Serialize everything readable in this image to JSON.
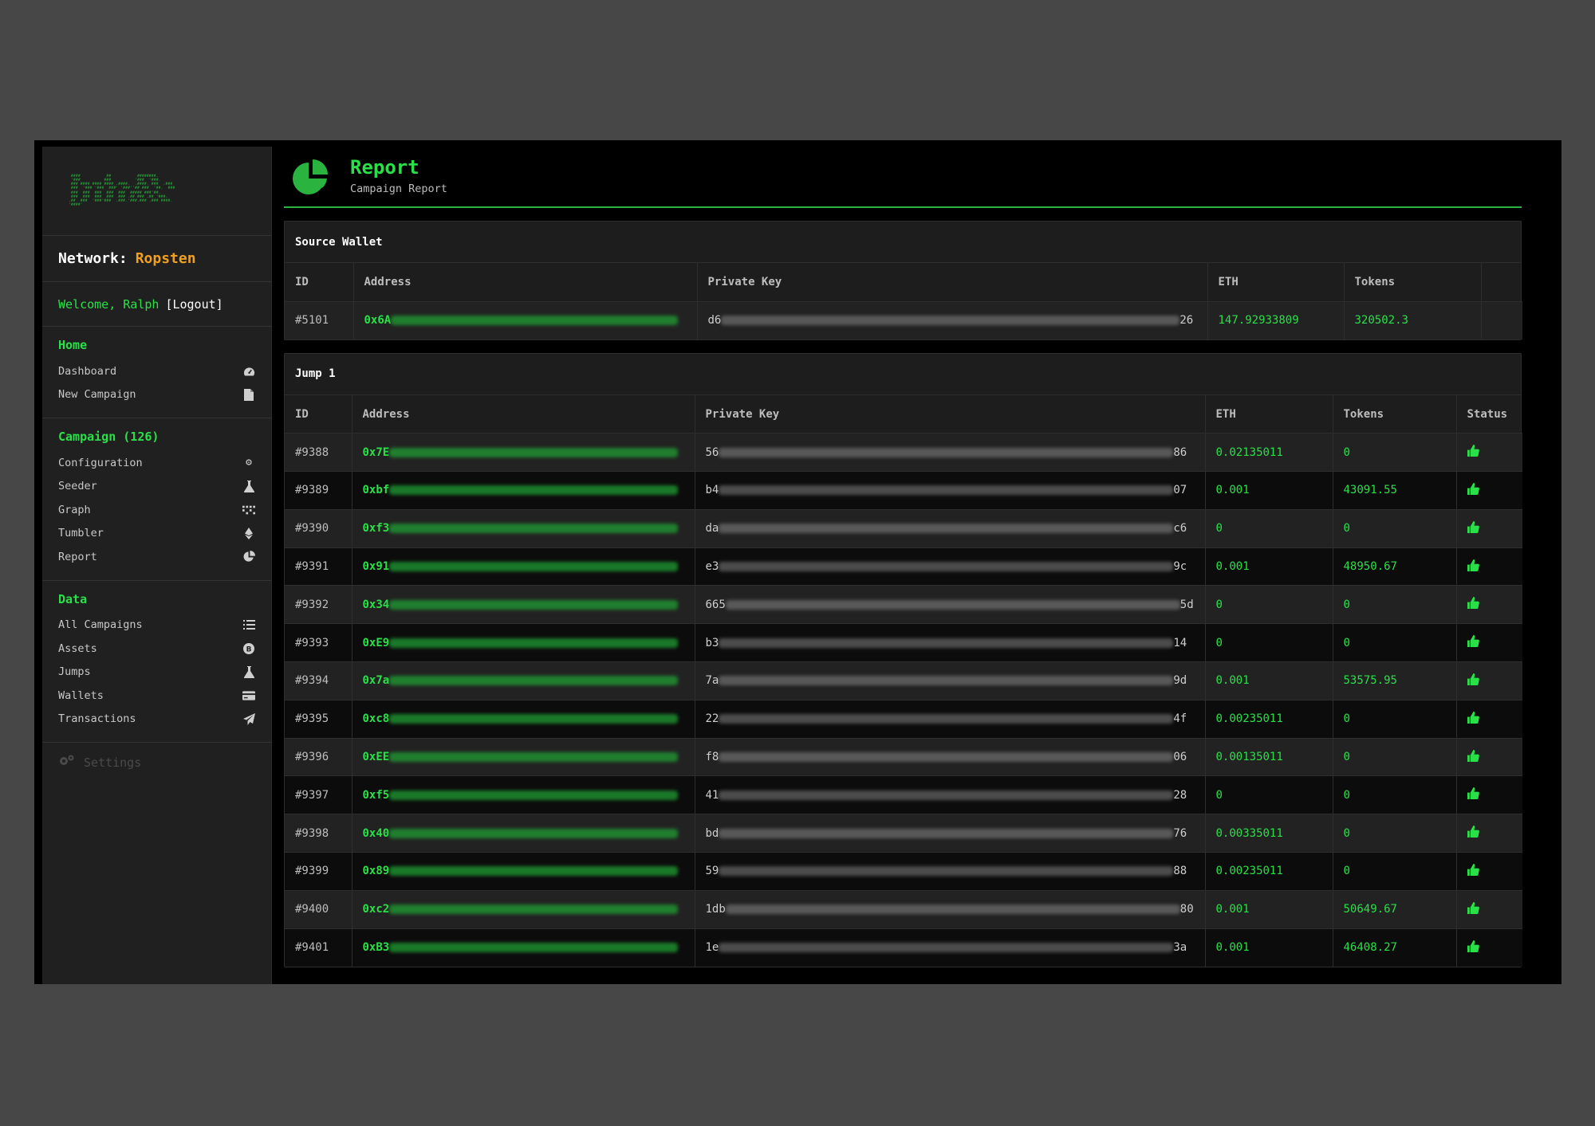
{
  "sidebar": {
    "network_label": "Network:",
    "network_value": "Ropsten",
    "welcome": "Welcome, Ralph",
    "logout": "[Logout]",
    "home_heading": "Home",
    "home_items": [
      {
        "label": "Dashboard",
        "icon": "dashboard-icon"
      },
      {
        "label": "New Campaign",
        "icon": "file-icon"
      }
    ],
    "campaign_heading": "Campaign (126)",
    "campaign_items": [
      {
        "label": "Configuration",
        "icon": "gear-icon"
      },
      {
        "label": "Seeder",
        "icon": "flask-icon"
      },
      {
        "label": "Graph",
        "icon": "graph-icon"
      },
      {
        "label": "Tumbler",
        "icon": "ethereum-icon"
      },
      {
        "label": "Report",
        "icon": "pie-chart-icon"
      }
    ],
    "data_heading": "Data",
    "data_items": [
      {
        "label": "All Campaigns",
        "icon": "list-icon"
      },
      {
        "label": "Assets",
        "icon": "coin-icon"
      },
      {
        "label": "Jumps",
        "icon": "flask-icon"
      },
      {
        "label": "Wallets",
        "icon": "credit-card-icon"
      },
      {
        "label": "Transactions",
        "icon": "paper-plane-icon"
      }
    ],
    "settings": "Settings"
  },
  "header": {
    "title": "Report",
    "subtitle": "Campaign Report"
  },
  "source_wallet": {
    "title": "Source Wallet",
    "columns": [
      "ID",
      "Address",
      "Private Key",
      "ETH",
      "Tokens"
    ],
    "row": {
      "id": "#5101",
      "addr_prefix": "0x6A",
      "key_prefix": "d6",
      "key_suffix": "26",
      "eth": "147.92933809",
      "tokens": "320502.3"
    }
  },
  "jump": {
    "title": "Jump 1",
    "columns": [
      "ID",
      "Address",
      "Private Key",
      "ETH",
      "Tokens",
      "Status"
    ],
    "rows": [
      {
        "id": "#9388",
        "addr": "0x7E",
        "key": "56",
        "suffix": "86",
        "eth": "0.02135011",
        "tokens": "0"
      },
      {
        "id": "#9389",
        "addr": "0xbf",
        "key": "b4",
        "suffix": "07",
        "eth": "0.001",
        "tokens": "43091.55"
      },
      {
        "id": "#9390",
        "addr": "0xf3",
        "key": "da",
        "suffix": "c6",
        "eth": "0",
        "tokens": "0"
      },
      {
        "id": "#9391",
        "addr": "0x91",
        "key": "e3",
        "suffix": "9c",
        "eth": "0.001",
        "tokens": "48950.67"
      },
      {
        "id": "#9392",
        "addr": "0x34",
        "key": "665",
        "suffix": "5d",
        "eth": "0",
        "tokens": "0"
      },
      {
        "id": "#9393",
        "addr": "0xE9",
        "key": "b3",
        "suffix": "14",
        "eth": "0",
        "tokens": "0"
      },
      {
        "id": "#9394",
        "addr": "0x7a",
        "key": "7a",
        "suffix": "9d",
        "eth": "0.001",
        "tokens": "53575.95"
      },
      {
        "id": "#9395",
        "addr": "0xc8",
        "key": "22",
        "suffix": "4f",
        "eth": "0.00235011",
        "tokens": "0"
      },
      {
        "id": "#9396",
        "addr": "0xEE",
        "key": "f8",
        "suffix": "06",
        "eth": "0.00135011",
        "tokens": "0"
      },
      {
        "id": "#9397",
        "addr": "0xf5",
        "key": "41",
        "suffix": "28",
        "eth": "0",
        "tokens": "0"
      },
      {
        "id": "#9398",
        "addr": "0x40",
        "key": "bd",
        "suffix": "76",
        "eth": "0.00335011",
        "tokens": "0"
      },
      {
        "id": "#9399",
        "addr": "0x89",
        "key": "59",
        "suffix": "88",
        "eth": "0.00235011",
        "tokens": "0"
      },
      {
        "id": "#9400",
        "addr": "0xc2",
        "key": "1db",
        "suffix": "80",
        "eth": "0.001",
        "tokens": "50649.67"
      },
      {
        "id": "#9401",
        "addr": "0xB3",
        "key": "1e",
        "suffix": "3a",
        "eth": "0.001",
        "tokens": "46408.27"
      }
    ]
  },
  "colors": {
    "accent_green": "#2ae048",
    "network_orange": "#f0a020",
    "background": "#000000"
  }
}
